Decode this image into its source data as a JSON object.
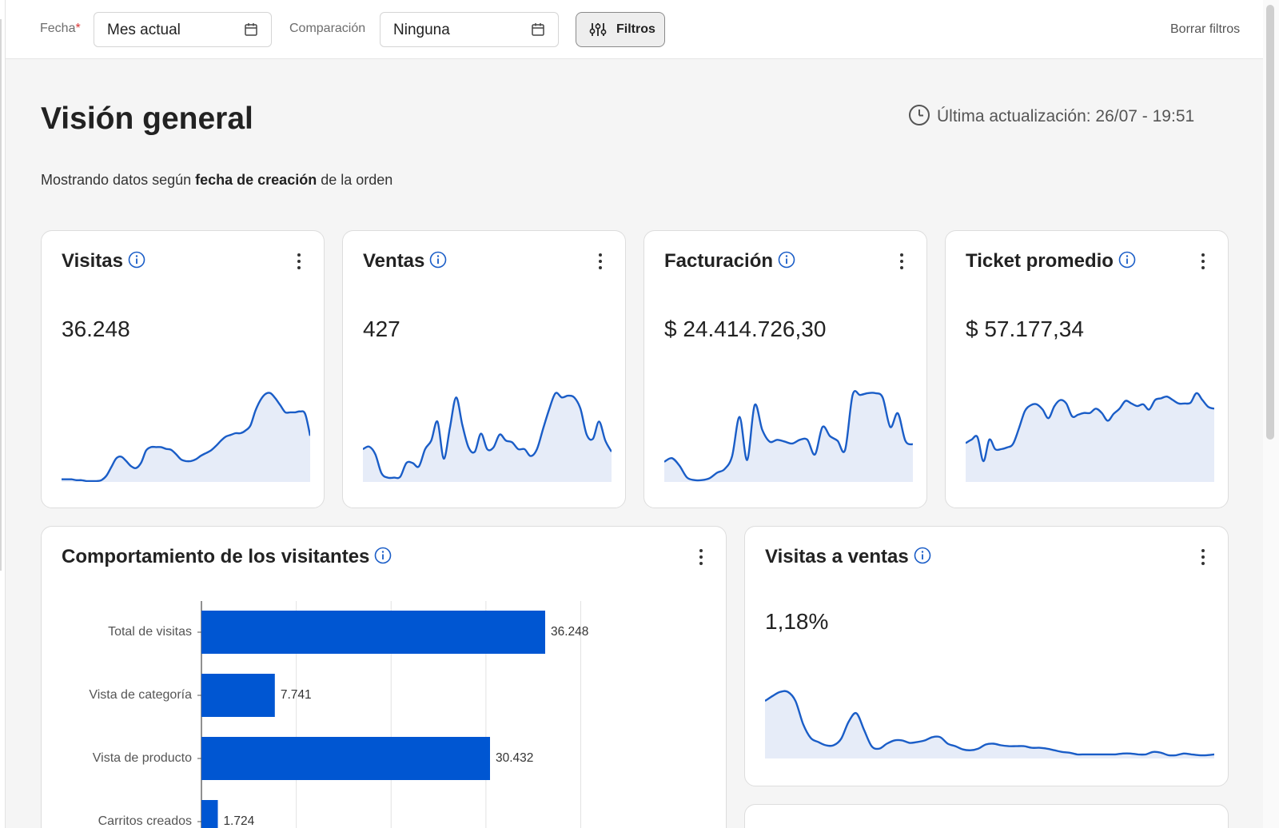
{
  "filters": {
    "date_label": "Fecha",
    "date_required_mark": "*",
    "date_value": "Mes actual",
    "comparison_label": "Comparación",
    "comparison_value": "Ninguna",
    "filters_button": "Filtros",
    "clear_filters": "Borrar filtros"
  },
  "header": {
    "title": "Visión general",
    "last_update": "Última actualización: 26/07 - 19:51",
    "subtitle_prefix": "Mostrando datos según ",
    "subtitle_bold": "fecha de creación",
    "subtitle_suffix": " de la orden"
  },
  "kpis": [
    {
      "title": "Visitas",
      "value": "36.248",
      "trend": [
        3,
        3,
        3,
        2,
        2,
        1,
        1,
        1,
        2,
        7,
        17,
        27,
        29,
        24,
        18,
        16,
        22,
        36,
        40,
        40,
        40,
        38,
        37,
        32,
        26,
        24,
        24,
        26,
        30,
        33,
        36,
        41,
        47,
        52,
        54,
        56,
        56,
        59,
        65,
        82,
        94,
        101,
        102,
        96,
        88,
        80,
        80,
        80,
        81,
        78,
        53
      ]
    },
    {
      "title": "Ventas",
      "value": "427",
      "trend": [
        38,
        41,
        32,
        10,
        5,
        5,
        6,
        22,
        22,
        18,
        38,
        48,
        70,
        27,
        63,
        98,
        66,
        40,
        35,
        56,
        38,
        40,
        55,
        48,
        46,
        38,
        38,
        30,
        38,
        62,
        85,
        103,
        98,
        100,
        98,
        85,
        55,
        50,
        70,
        48,
        35
      ]
    },
    {
      "title": "Facturación",
      "value": "$ 24.414.726,30",
      "trend": [
        22,
        26,
        18,
        5,
        2,
        2,
        4,
        10,
        14,
        28,
        71,
        24,
        84,
        57,
        44,
        46,
        44,
        42,
        46,
        46,
        30,
        60,
        50,
        45,
        35,
        95,
        95,
        97,
        97,
        92,
        60,
        75,
        45,
        41
      ]
    },
    {
      "title": "Ticket promedio",
      "value": "$ 57.177,34",
      "trend": [
        45,
        49,
        52,
        24,
        49,
        38,
        38,
        40,
        44,
        62,
        82,
        89,
        90,
        84,
        74,
        88,
        95,
        91,
        76,
        78,
        80,
        80,
        85,
        80,
        71,
        79,
        85,
        94,
        91,
        88,
        90,
        84,
        95,
        97,
        99,
        95,
        91,
        91,
        92,
        103,
        95,
        87,
        85
      ]
    }
  ],
  "visitor_behavior": {
    "title": "Comportamiento de los visitantes",
    "chart_data": {
      "type": "bar",
      "orientation": "horizontal",
      "categories": [
        "Total de visitas",
        "Vista de categoría",
        "Vista de producto",
        "Carritos creados"
      ],
      "values": [
        36248,
        7741,
        30432,
        1724
      ],
      "value_labels": [
        "36.248",
        "7.741",
        "30.432",
        "1.724"
      ],
      "xlim": [
        0,
        52000
      ],
      "grid": true,
      "color": "#0056d2"
    }
  },
  "visits_to_sales": {
    "title": "Visitas a ventas",
    "value": "1,18%",
    "trend": [
      70,
      76,
      81,
      81,
      70,
      42,
      25,
      20,
      16,
      16,
      24,
      45,
      55,
      35,
      15,
      12,
      18,
      22,
      22,
      19,
      20,
      22,
      26,
      26,
      18,
      15,
      11,
      10,
      12,
      17,
      18,
      16,
      15,
      15,
      15,
      13,
      13,
      12,
      10,
      8,
      7,
      5,
      5,
      5,
      5,
      5,
      5,
      6,
      6,
      5,
      5,
      8,
      7,
      4,
      4,
      6,
      5,
      4,
      4,
      5
    ]
  },
  "colors": {
    "accent": "#0056d2",
    "line": "#1a5dc7",
    "fill": "#e6ecf8"
  }
}
